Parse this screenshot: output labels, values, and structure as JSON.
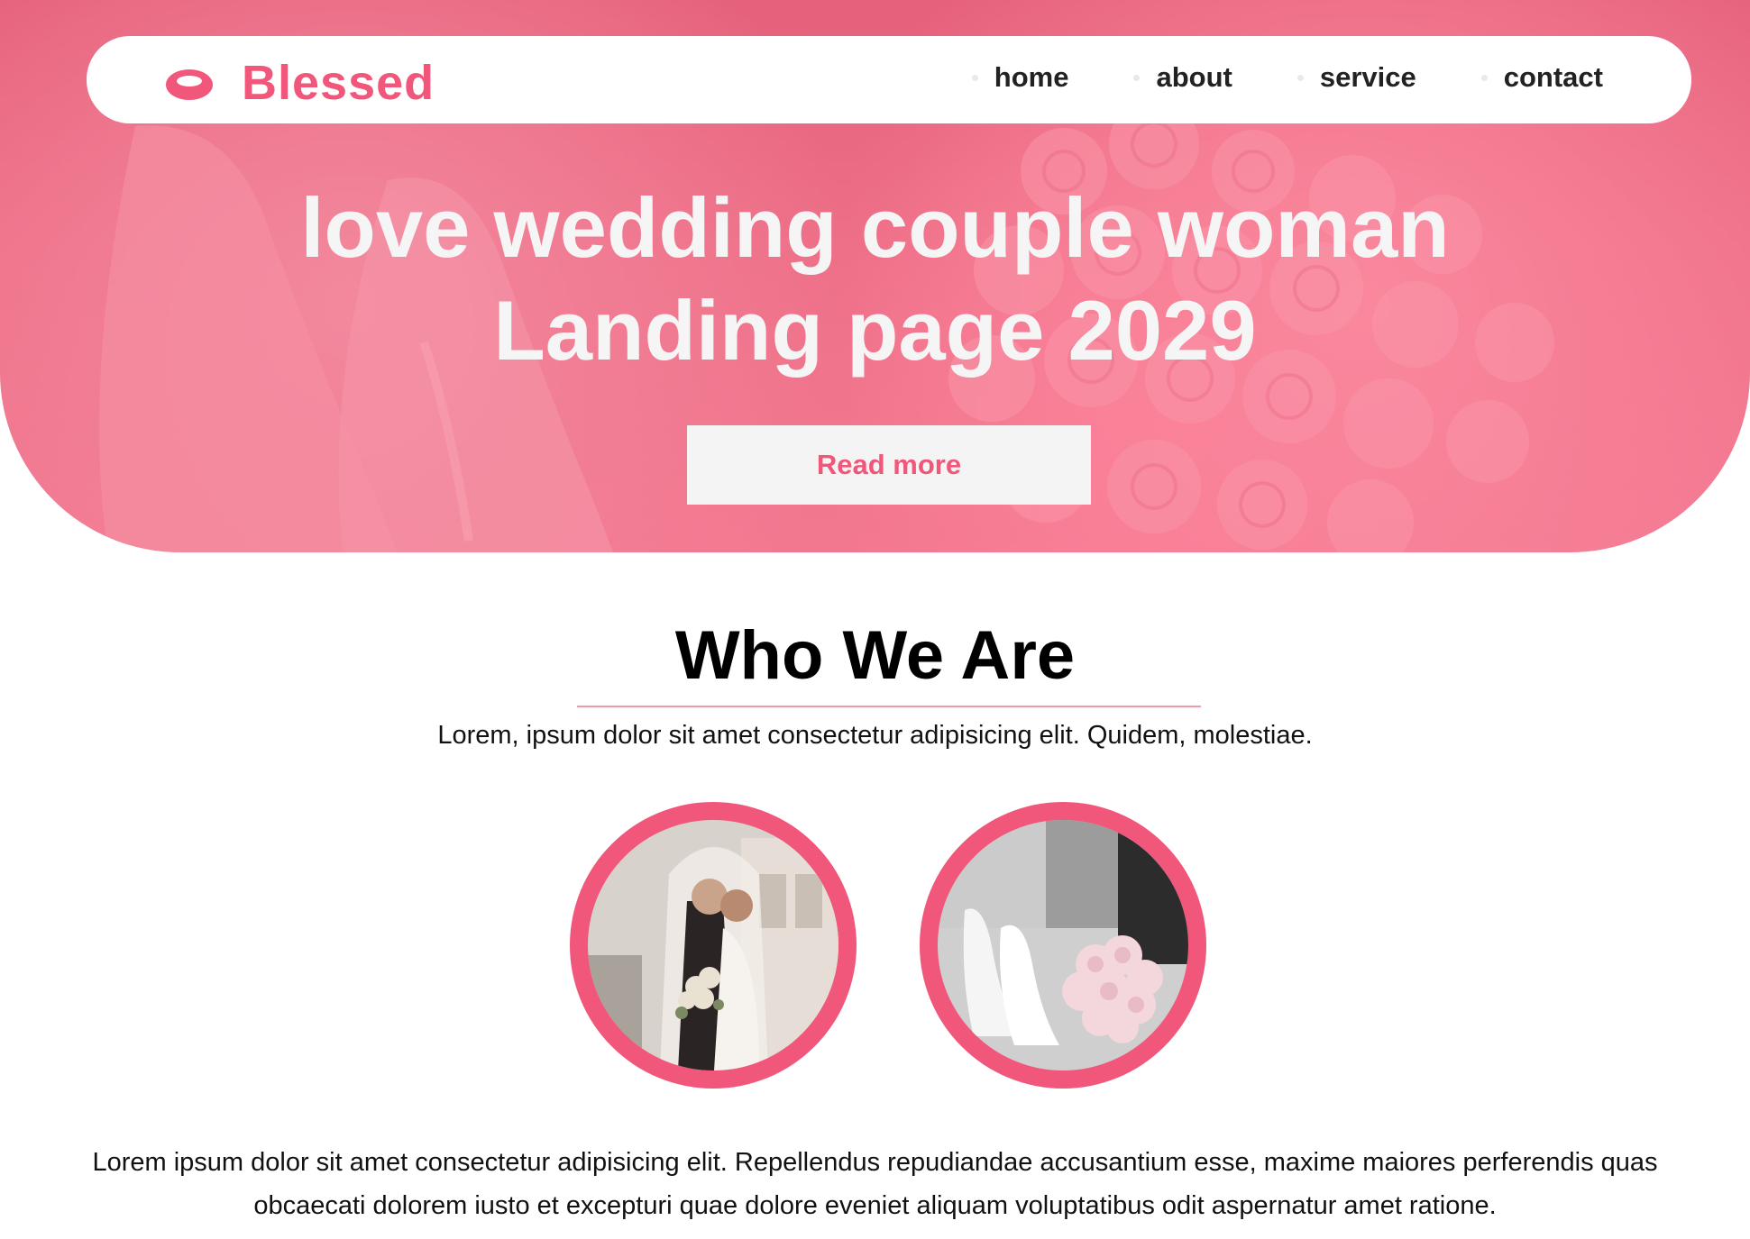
{
  "brand": {
    "name": "Blessed",
    "icon": "ring-icon",
    "color": "#f0577a"
  },
  "nav": {
    "items": [
      {
        "label": "home"
      },
      {
        "label": "about"
      },
      {
        "label": "service"
      },
      {
        "label": "contact"
      }
    ]
  },
  "hero": {
    "title_line1": "love wedding couple woman",
    "title_line2": "Landing page 2029",
    "cta_label": "Read more",
    "overlay_color": "#f05c78"
  },
  "about": {
    "title": "Who We Are",
    "subtitle": "Lorem, ipsum dolor sit amet consectetur adipisicing elit. Quidem, molestiae.",
    "images": [
      {
        "name": "wedding-couple-photo"
      },
      {
        "name": "wedding-shoes-bouquet-photo"
      }
    ],
    "paragraph": "Lorem ipsum dolor sit amet consectetur adipisicing elit. Repellendus repudiandae accusantium esse, maxime maiores perferendis quas obcaecati dolorem iusto et excepturi quae dolore eveniet aliquam voluptatibus odit aspernatur amet ratione."
  }
}
